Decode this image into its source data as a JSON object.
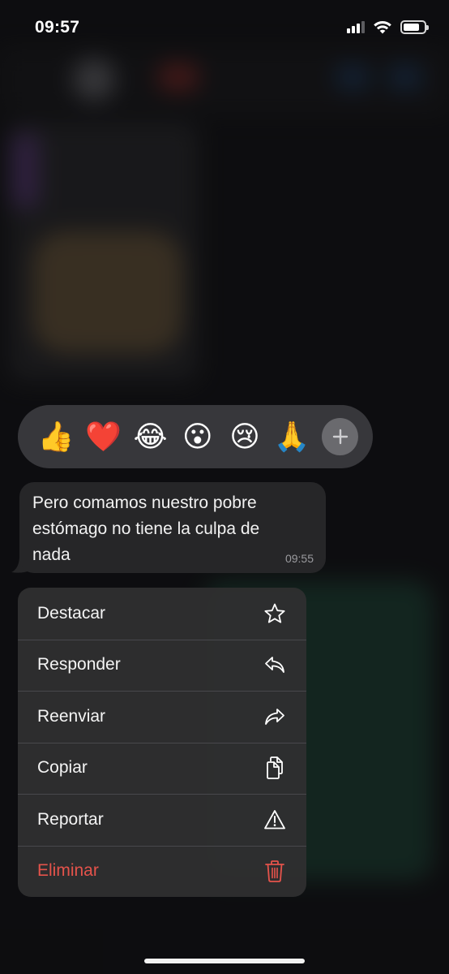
{
  "status_bar": {
    "time": "09:57",
    "icons": [
      "signal-icon",
      "wifi-icon",
      "battery-icon"
    ]
  },
  "reactions": {
    "items": [
      {
        "emoji": "👍",
        "name": "thumbs-up"
      },
      {
        "emoji": "❤️",
        "name": "red-heart"
      },
      {
        "emoji": "😂",
        "name": "tears-of-joy"
      },
      {
        "emoji": "😮",
        "name": "surprised"
      },
      {
        "emoji": "😢",
        "name": "crying"
      },
      {
        "emoji": "🙏",
        "name": "folded-hands"
      }
    ],
    "more_icon": "plus-icon"
  },
  "message": {
    "text": "Pero comamos nuestro pobre estómago no tiene la culpa de nada",
    "time": "09:55"
  },
  "menu": {
    "items": [
      {
        "label": "Destacar",
        "icon": "star-icon"
      },
      {
        "label": "Responder",
        "icon": "reply-icon"
      },
      {
        "label": "Reenviar",
        "icon": "forward-icon"
      },
      {
        "label": "Copiar",
        "icon": "copy-icon"
      },
      {
        "label": "Reportar",
        "icon": "warning-icon"
      },
      {
        "label": "Eliminar",
        "icon": "trash-icon",
        "destructive": true
      }
    ]
  },
  "colors": {
    "background": "#121214",
    "bubble": "#262628",
    "menu": "#2e2e30",
    "destructive": "#e5534b"
  }
}
